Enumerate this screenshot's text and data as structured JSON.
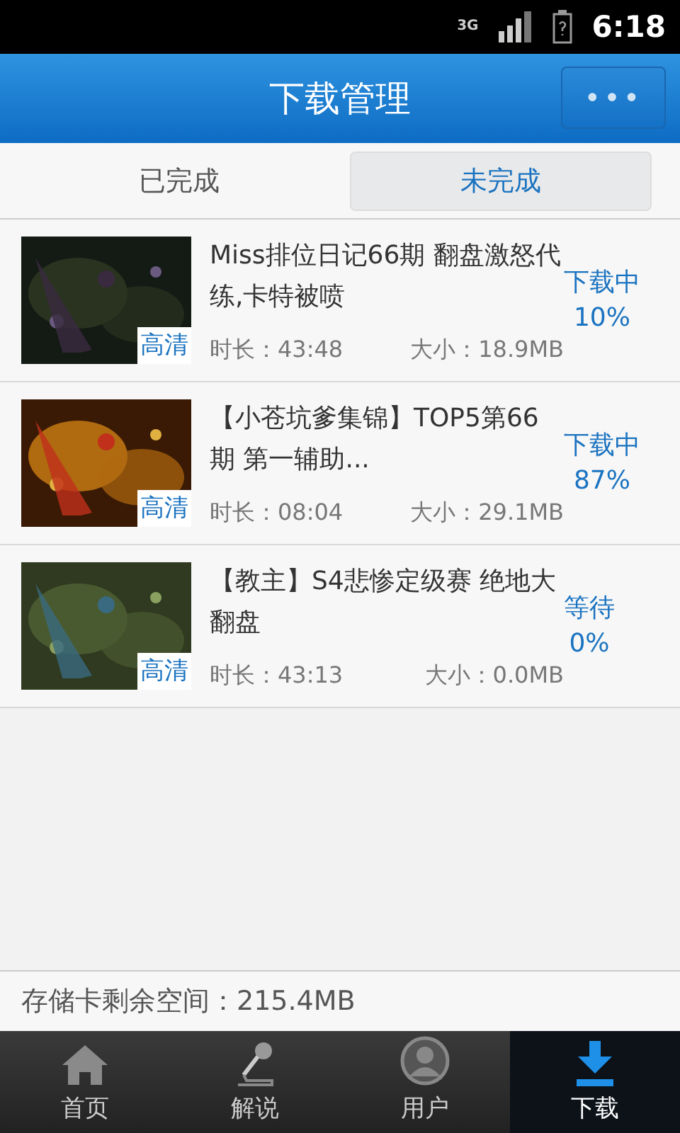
{
  "status_bar": {
    "network": "3G",
    "time": "6:18"
  },
  "header": {
    "title": "下载管理",
    "menu": "•••"
  },
  "tabs": [
    {
      "label": "已完成",
      "selected": false
    },
    {
      "label": "未完成",
      "selected": true
    }
  ],
  "downloads": [
    {
      "title": "Miss排位日记66期 翻盘激怒代练,卡特被喷",
      "badge": "高清",
      "duration": "时长：43:48",
      "size": "大小：18.9MB",
      "status": "下载中",
      "percent": "10%"
    },
    {
      "title": "【小苍坑爹集锦】TOP5第66期 第一辅助...",
      "badge": "高清",
      "duration": "时长：08:04",
      "size": "大小：29.1MB",
      "status": "下载中",
      "percent": "87%"
    },
    {
      "title": "【教主】S4悲惨定级赛 绝地大翻盘",
      "badge": "高清",
      "duration": "时长：43:13",
      "size": "大小：0.0MB",
      "status": "等待",
      "percent": "0%"
    }
  ],
  "storage": "存储卡剩余空间：215.4MB",
  "nav": [
    {
      "label": "首页",
      "selected": false
    },
    {
      "label": "解说",
      "selected": false
    },
    {
      "label": "用户",
      "selected": false
    },
    {
      "label": "下载",
      "selected": true
    }
  ]
}
